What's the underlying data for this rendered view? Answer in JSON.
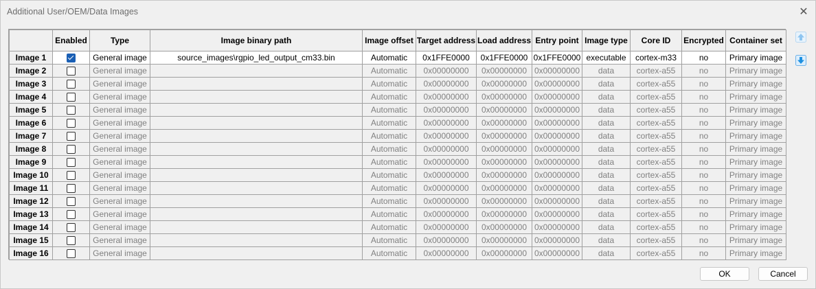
{
  "window": {
    "title": "Additional User/OEM/Data Images",
    "close_glyph": "✕"
  },
  "table": {
    "columns": [
      "Enabled",
      "Type",
      "Image binary path",
      "Image offset",
      "Target address",
      "Load address",
      "Entry point",
      "Image type",
      "Core ID",
      "Encrypted",
      "Container set"
    ],
    "rows": [
      {
        "label": "Image 1",
        "enabled": true,
        "type": "General image",
        "path": "source_images\\rgpio_led_output_cm33.bin",
        "offset": "Automatic",
        "target": "0x1FFE0000",
        "load": "0x1FFE0000",
        "entry": "0x1FFE0000",
        "image_type": "executable",
        "core": "cortex-m33",
        "encrypted": "no",
        "container": "Primary image"
      },
      {
        "label": "Image 2",
        "enabled": false,
        "type": "General image",
        "path": "",
        "offset": "Automatic",
        "target": "0x00000000",
        "load": "0x00000000",
        "entry": "0x00000000",
        "image_type": "data",
        "core": "cortex-a55",
        "encrypted": "no",
        "container": "Primary image"
      },
      {
        "label": "Image 3",
        "enabled": false,
        "type": "General image",
        "path": "",
        "offset": "Automatic",
        "target": "0x00000000",
        "load": "0x00000000",
        "entry": "0x00000000",
        "image_type": "data",
        "core": "cortex-a55",
        "encrypted": "no",
        "container": "Primary image"
      },
      {
        "label": "Image 4",
        "enabled": false,
        "type": "General image",
        "path": "",
        "offset": "Automatic",
        "target": "0x00000000",
        "load": "0x00000000",
        "entry": "0x00000000",
        "image_type": "data",
        "core": "cortex-a55",
        "encrypted": "no",
        "container": "Primary image"
      },
      {
        "label": "Image 5",
        "enabled": false,
        "type": "General image",
        "path": "",
        "offset": "Automatic",
        "target": "0x00000000",
        "load": "0x00000000",
        "entry": "0x00000000",
        "image_type": "data",
        "core": "cortex-a55",
        "encrypted": "no",
        "container": "Primary image"
      },
      {
        "label": "Image 6",
        "enabled": false,
        "type": "General image",
        "path": "",
        "offset": "Automatic",
        "target": "0x00000000",
        "load": "0x00000000",
        "entry": "0x00000000",
        "image_type": "data",
        "core": "cortex-a55",
        "encrypted": "no",
        "container": "Primary image"
      },
      {
        "label": "Image 7",
        "enabled": false,
        "type": "General image",
        "path": "",
        "offset": "Automatic",
        "target": "0x00000000",
        "load": "0x00000000",
        "entry": "0x00000000",
        "image_type": "data",
        "core": "cortex-a55",
        "encrypted": "no",
        "container": "Primary image"
      },
      {
        "label": "Image 8",
        "enabled": false,
        "type": "General image",
        "path": "",
        "offset": "Automatic",
        "target": "0x00000000",
        "load": "0x00000000",
        "entry": "0x00000000",
        "image_type": "data",
        "core": "cortex-a55",
        "encrypted": "no",
        "container": "Primary image"
      },
      {
        "label": "Image 9",
        "enabled": false,
        "type": "General image",
        "path": "",
        "offset": "Automatic",
        "target": "0x00000000",
        "load": "0x00000000",
        "entry": "0x00000000",
        "image_type": "data",
        "core": "cortex-a55",
        "encrypted": "no",
        "container": "Primary image"
      },
      {
        "label": "Image 10",
        "enabled": false,
        "type": "General image",
        "path": "",
        "offset": "Automatic",
        "target": "0x00000000",
        "load": "0x00000000",
        "entry": "0x00000000",
        "image_type": "data",
        "core": "cortex-a55",
        "encrypted": "no",
        "container": "Primary image"
      },
      {
        "label": "Image 11",
        "enabled": false,
        "type": "General image",
        "path": "",
        "offset": "Automatic",
        "target": "0x00000000",
        "load": "0x00000000",
        "entry": "0x00000000",
        "image_type": "data",
        "core": "cortex-a55",
        "encrypted": "no",
        "container": "Primary image"
      },
      {
        "label": "Image 12",
        "enabled": false,
        "type": "General image",
        "path": "",
        "offset": "Automatic",
        "target": "0x00000000",
        "load": "0x00000000",
        "entry": "0x00000000",
        "image_type": "data",
        "core": "cortex-a55",
        "encrypted": "no",
        "container": "Primary image"
      },
      {
        "label": "Image 13",
        "enabled": false,
        "type": "General image",
        "path": "",
        "offset": "Automatic",
        "target": "0x00000000",
        "load": "0x00000000",
        "entry": "0x00000000",
        "image_type": "data",
        "core": "cortex-a55",
        "encrypted": "no",
        "container": "Primary image"
      },
      {
        "label": "Image 14",
        "enabled": false,
        "type": "General image",
        "path": "",
        "offset": "Automatic",
        "target": "0x00000000",
        "load": "0x00000000",
        "entry": "0x00000000",
        "image_type": "data",
        "core": "cortex-a55",
        "encrypted": "no",
        "container": "Primary image"
      },
      {
        "label": "Image 15",
        "enabled": false,
        "type": "General image",
        "path": "",
        "offset": "Automatic",
        "target": "0x00000000",
        "load": "0x00000000",
        "entry": "0x00000000",
        "image_type": "data",
        "core": "cortex-a55",
        "encrypted": "no",
        "container": "Primary image"
      },
      {
        "label": "Image 16",
        "enabled": false,
        "type": "General image",
        "path": "",
        "offset": "Automatic",
        "target": "0x00000000",
        "load": "0x00000000",
        "entry": "0x00000000",
        "image_type": "data",
        "core": "cortex-a55",
        "encrypted": "no",
        "container": "Primary image"
      }
    ]
  },
  "side_buttons": {
    "up_icon": "arrow-up-icon",
    "down_icon": "arrow-down-icon"
  },
  "buttons": {
    "ok": "OK",
    "cancel": "Cancel"
  },
  "colors": {
    "accent": "#1a5fb4",
    "disabled_text": "#808080",
    "arrow_up": "#8ec5f0",
    "arrow_down": "#1e90e0"
  }
}
